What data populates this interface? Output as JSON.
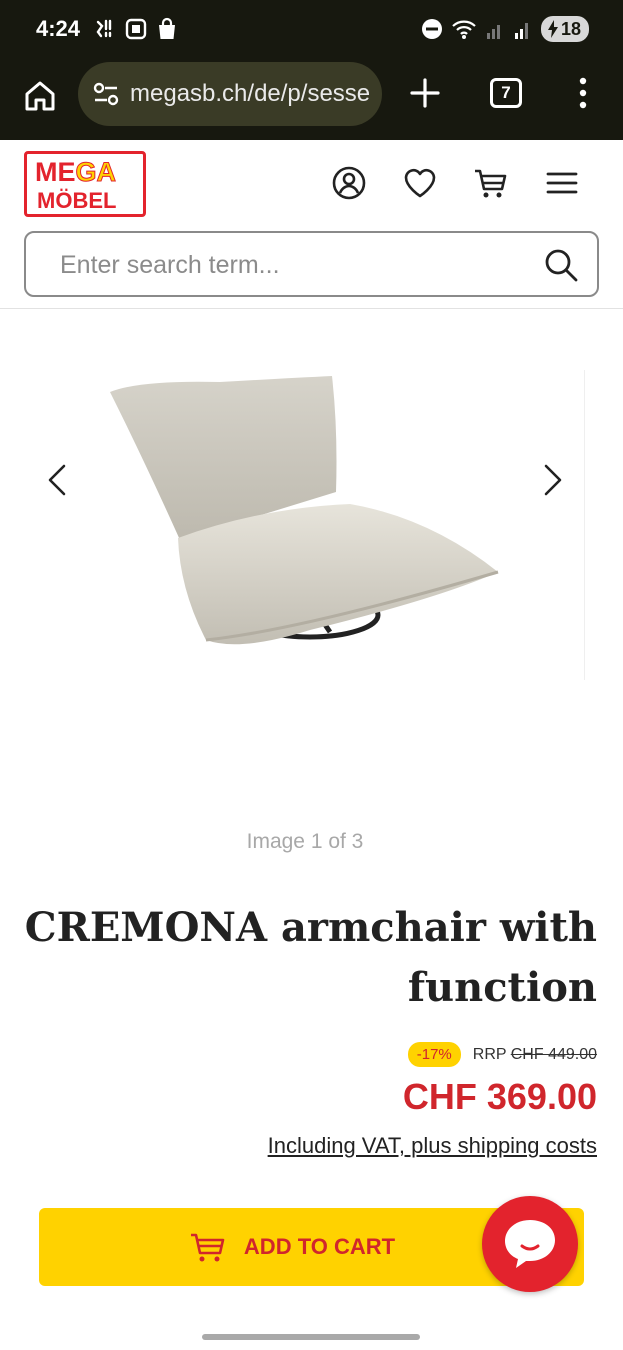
{
  "status_bar": {
    "time": "4:24",
    "battery": "18"
  },
  "browser": {
    "url": "megasb.ch/de/p/sessel-cremona",
    "tab_count": "7"
  },
  "header": {
    "logo_top_a": "ME",
    "logo_top_b": "GA",
    "logo_bottom": "MÖBEL",
    "search_placeholder": "Enter search term..."
  },
  "gallery": {
    "counter": "Image 1 of 3"
  },
  "product": {
    "title": "CREMONA armchair with function",
    "discount": "-17%",
    "rrp_label": "RRP",
    "rrp_price": "CHF 449.00",
    "price": "CHF 369.00",
    "vat_note": "Including VAT, plus shipping costs",
    "add_to_cart": "ADD TO CART"
  },
  "colors": {
    "brand_red": "#e3232d",
    "brand_yellow": "#ffd200",
    "browser_dark": "#17180f"
  },
  "icons": [
    "home-icon",
    "site-settings-icon",
    "plus-icon",
    "tabs-icon",
    "more-icon",
    "account-icon",
    "heart-icon",
    "cart-icon",
    "hamburger-icon",
    "search-icon",
    "chevron-left-icon",
    "chevron-right-icon",
    "chat-icon"
  ]
}
